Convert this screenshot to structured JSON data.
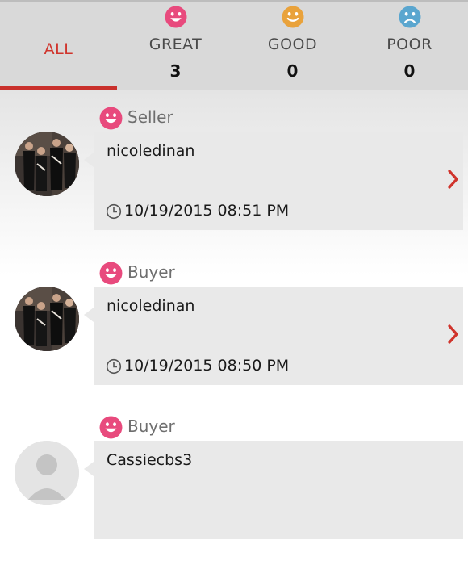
{
  "tabs": [
    {
      "label": "ALL",
      "count": "",
      "active": true
    },
    {
      "label": "GREAT",
      "count": "3",
      "face_icon": "smile-icon",
      "color": "#e84a7d"
    },
    {
      "label": "GOOD",
      "count": "0",
      "face_icon": "smile-icon",
      "color": "#e9a23b"
    },
    {
      "label": "POOR",
      "count": "0",
      "face_icon": "frown-icon",
      "color": "#5aa6cf"
    }
  ],
  "feedback": [
    {
      "role": "Seller",
      "role_icon": "smile-icon",
      "username": "nicoledinan",
      "datetime": "10/19/2015 08:51 PM",
      "avatar": "user-photo"
    },
    {
      "role": "Buyer",
      "role_icon": "smile-icon",
      "username": "nicoledinan",
      "datetime": "10/19/2015 08:50 PM",
      "avatar": "user-photo"
    },
    {
      "role": "Buyer",
      "role_icon": "smile-icon",
      "username": "Cassiecbs3",
      "datetime": "",
      "avatar": "default-avatar"
    }
  ],
  "colors": {
    "accent_red": "#c9302c",
    "great_pink": "#e84a7d",
    "good_orange": "#e9a23b",
    "poor_blue": "#5aa6cf",
    "card_bg": "#e9e9e9",
    "header_bg": "#d9d9d9"
  }
}
